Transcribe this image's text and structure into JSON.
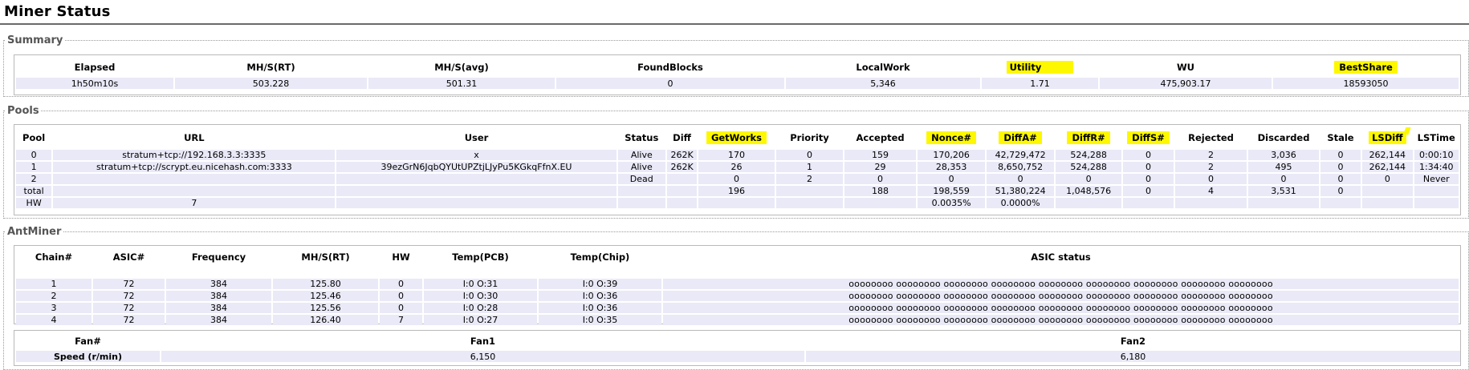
{
  "page": {
    "title": "Miner Status"
  },
  "summary": {
    "legend": "Summary",
    "headers": [
      "Elapsed",
      "MH/S(RT)",
      "MH/S(avg)",
      "FoundBlocks",
      "LocalWork",
      "Utility",
      "WU",
      "BestShare"
    ],
    "values": [
      "1h50m10s",
      "503.228",
      "501.31",
      "0",
      "5,346",
      "1.71",
      "475,903.17",
      "18593050"
    ]
  },
  "pools": {
    "legend": "Pools",
    "headers": [
      "Pool",
      "URL",
      "User",
      "Status",
      "Diff",
      "GetWorks",
      "Priority",
      "Accepted",
      "Nonce#",
      "DiffA#",
      "DiffR#",
      "DiffS#",
      "Rejected",
      "Discarded",
      "Stale",
      "LSDiff",
      "LSTime"
    ],
    "rows": [
      [
        "0",
        "stratum+tcp://192.168.3.3:3335",
        "x",
        "Alive",
        "262K",
        "170",
        "0",
        "159",
        "170,206",
        "42,729,472",
        "524,288",
        "0",
        "2",
        "3,036",
        "0",
        "262,144",
        "0:00:10"
      ],
      [
        "1",
        "stratum+tcp://scrypt.eu.nicehash.com:3333",
        "39ezGrN6JqbQYUtUPZtjLJyPu5KGkqFfnX.EU",
        "Alive",
        "262K",
        "26",
        "1",
        "29",
        "28,353",
        "8,650,752",
        "524,288",
        "0",
        "2",
        "495",
        "0",
        "262,144",
        "1:34:40"
      ],
      [
        "2",
        "",
        "",
        "Dead",
        "",
        "0",
        "2",
        "0",
        "0",
        "0",
        "0",
        "0",
        "0",
        "0",
        "0",
        "0",
        "Never"
      ],
      [
        "total",
        "",
        "",
        "",
        "",
        "196",
        "",
        "188",
        "198,559",
        "51,380,224",
        "1,048,576",
        "0",
        "4",
        "3,531",
        "0",
        "",
        ""
      ],
      [
        "HW",
        "7",
        "",
        "",
        "",
        "",
        "",
        "",
        "0.0035%",
        "0.0000%",
        "",
        "",
        "",
        "",
        "",
        "",
        ""
      ]
    ]
  },
  "antminer": {
    "legend": "AntMiner",
    "chain_headers": [
      "Chain#",
      "ASIC#",
      "Frequency",
      "MH/S(RT)",
      "HW",
      "Temp(PCB)",
      "Temp(Chip)",
      "ASIC status"
    ],
    "chains": [
      [
        "1",
        "72",
        "384",
        "125.80",
        "0",
        "I:0 O:31",
        "I:0 O:39",
        "oooooooo oooooooo oooooooo oooooooo oooooooo oooooooo oooooooo oooooooo oooooooo"
      ],
      [
        "2",
        "72",
        "384",
        "125.46",
        "0",
        "I:0 O:30",
        "I:0 O:36",
        "oooooooo oooooooo oooooooo oooooooo oooooooo oooooooo oooooooo oooooooo oooooooo"
      ],
      [
        "3",
        "72",
        "384",
        "125.56",
        "0",
        "I:0 O:28",
        "I:0 O:36",
        "oooooooo oooooooo oooooooo oooooooo oooooooo oooooooo oooooooo oooooooo oooooooo"
      ],
      [
        "4",
        "72",
        "384",
        "126.40",
        "7",
        "I:0 O:27",
        "I:0 O:35",
        "oooooooo oooooooo oooooooo oooooooo oooooooo oooooooo oooooooo oooooooo oooooooo"
      ]
    ],
    "fan_headers": [
      "Fan#",
      "Fan1",
      "Fan2"
    ],
    "fan_row_label": "Speed (r/min)",
    "fan_values": [
      "6,150",
      "6,180"
    ]
  },
  "colors": {
    "highlight": "#fdf800",
    "cell_bg": "#e9e9f7",
    "rule": "#6a6a6a"
  }
}
